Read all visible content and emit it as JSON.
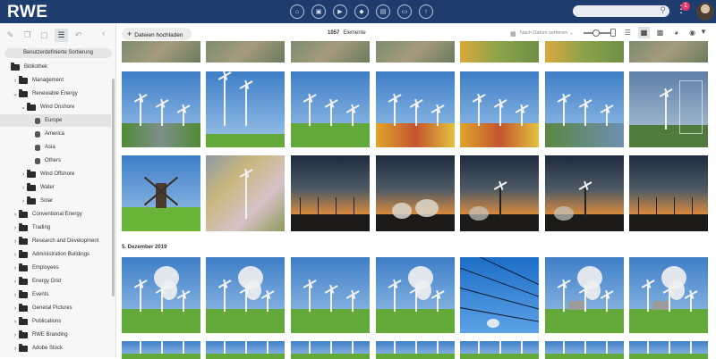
{
  "header": {
    "logo_text": "RWE",
    "search_placeholder": "",
    "notification_count": "1",
    "accent_color": "#1e3d6e",
    "nav_icons": [
      "home-icon",
      "image-icon",
      "video-icon",
      "bag-icon",
      "document-icon",
      "box-icon",
      "upload-icon"
    ]
  },
  "sidebar": {
    "sort_button": "Benutzerdefinierte Sortierung",
    "tree": [
      {
        "label": "Bibliothek",
        "level": 0,
        "chevron": "",
        "icon": "folder",
        "selected": false
      },
      {
        "label": "Management",
        "level": 1,
        "chevron": "›",
        "icon": "folder",
        "selected": false
      },
      {
        "label": "Renewable Energy",
        "level": 1,
        "chevron": "⌄",
        "icon": "folder",
        "selected": false
      },
      {
        "label": "Wind Onshore",
        "level": 2,
        "chevron": "⌄",
        "icon": "folder",
        "selected": false
      },
      {
        "label": "Europe",
        "level": 3,
        "chevron": "",
        "icon": "db",
        "selected": true
      },
      {
        "label": "America",
        "level": 3,
        "chevron": "",
        "icon": "db",
        "selected": false
      },
      {
        "label": "Asia",
        "level": 3,
        "chevron": "",
        "icon": "db",
        "selected": false
      },
      {
        "label": "Others",
        "level": 3,
        "chevron": "",
        "icon": "db",
        "selected": false
      },
      {
        "label": "Wind Offshore",
        "level": 2,
        "chevron": "›",
        "icon": "folder",
        "selected": false
      },
      {
        "label": "Water",
        "level": 2,
        "chevron": "›",
        "icon": "folder",
        "selected": false
      },
      {
        "label": "Solar",
        "level": 2,
        "chevron": "›",
        "icon": "folder",
        "selected": false
      },
      {
        "label": "Conventional Energy",
        "level": 1,
        "chevron": "›",
        "icon": "folder",
        "selected": false
      },
      {
        "label": "Trading",
        "level": 1,
        "chevron": "›",
        "icon": "folder",
        "selected": false
      },
      {
        "label": "Research and Development",
        "level": 1,
        "chevron": "›",
        "icon": "folder",
        "selected": false
      },
      {
        "label": "Administration Buildings",
        "level": 1,
        "chevron": "›",
        "icon": "folder",
        "selected": false
      },
      {
        "label": "Employees",
        "level": 1,
        "chevron": "›",
        "icon": "folder",
        "selected": false
      },
      {
        "label": "Energy Grid",
        "level": 1,
        "chevron": "›",
        "icon": "folder",
        "selected": false
      },
      {
        "label": "Events",
        "level": 1,
        "chevron": "›",
        "icon": "folder",
        "selected": false
      },
      {
        "label": "General Pictures",
        "level": 1,
        "chevron": "›",
        "icon": "folder",
        "selected": false
      },
      {
        "label": "Publications",
        "level": 1,
        "chevron": "›",
        "icon": "folder",
        "selected": false
      },
      {
        "label": "RWE Branding",
        "level": 1,
        "chevron": "›",
        "icon": "folder",
        "selected": false
      },
      {
        "label": "Adobe Stock",
        "level": 1,
        "chevron": "›",
        "icon": "folder",
        "selected": false
      }
    ]
  },
  "toolbar": {
    "upload_label": "Dateien hochladen",
    "element_count": "1057",
    "element_label": "Elemente",
    "sort_label": "Nach Datum sortieren",
    "view_icons": [
      "list-view-icon",
      "grid-view-icon",
      "large-grid-icon",
      "folder-view-icon",
      "map-view-icon"
    ]
  },
  "gallery": {
    "date_header": "5. Dezember 2019",
    "thumbnails": [
      {
        "scene": "aerial"
      },
      {
        "scene": "aerial"
      },
      {
        "scene": "aerial"
      },
      {
        "scene": "aerial"
      },
      {
        "scene": "aerial-flowers"
      },
      {
        "scene": "aerial-flowers"
      },
      {
        "scene": "aerial"
      },
      {
        "scene": "wind-road"
      },
      {
        "scene": "wind-close"
      },
      {
        "scene": "wind-field"
      },
      {
        "scene": "wind-tulips"
      },
      {
        "scene": "wind-tulips"
      },
      {
        "scene": "wind-water"
      },
      {
        "scene": "data-overlay"
      },
      {
        "scene": "windmill"
      },
      {
        "scene": "aerial-tulips"
      },
      {
        "scene": "sunset-pylons"
      },
      {
        "scene": "sunset-plant"
      },
      {
        "scene": "sunset-wind"
      },
      {
        "scene": "sunset-wind"
      },
      {
        "scene": "sunset-pylons"
      },
      {
        "scene": "plant-field"
      },
      {
        "scene": "plant-field"
      },
      {
        "scene": "wind-field"
      },
      {
        "scene": "plant-field"
      },
      {
        "scene": "sky-lines"
      },
      {
        "scene": "plant-wind"
      },
      {
        "scene": "plant-wind"
      },
      {
        "scene": "wind-field"
      },
      {
        "scene": "wind-field"
      },
      {
        "scene": "wind-field"
      },
      {
        "scene": "wind-field"
      },
      {
        "scene": "wind-field"
      },
      {
        "scene": "wind-field"
      },
      {
        "scene": "wind-field"
      }
    ]
  }
}
